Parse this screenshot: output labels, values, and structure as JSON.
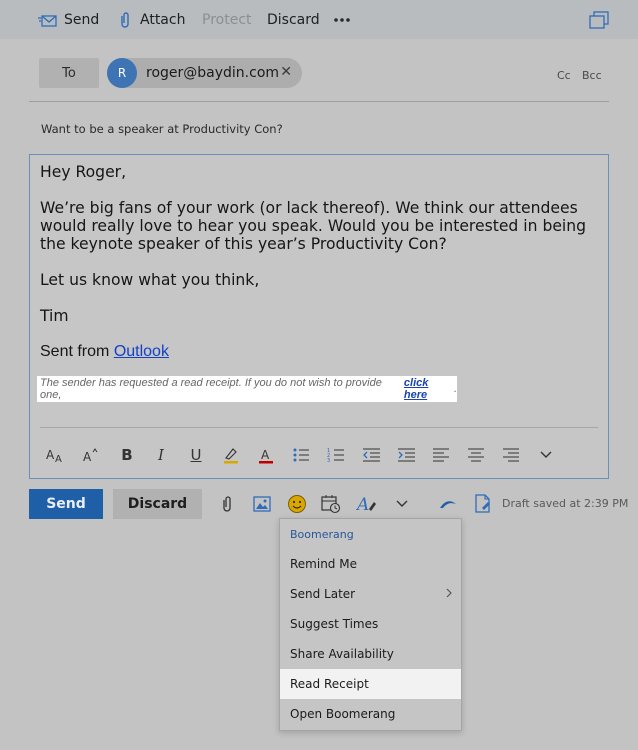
{
  "toolbar": {
    "send": "Send",
    "attach": "Attach",
    "protect": "Protect",
    "discard": "Discard"
  },
  "recipients": {
    "to_label": "To",
    "items": [
      {
        "initial": "R",
        "email": "roger@baydin.com"
      }
    ],
    "cc": "Cc",
    "bcc": "Bcc"
  },
  "subject": "Want to be a speaker at Productivity Con?",
  "body": {
    "greeting": "Hey Roger,",
    "paragraph": "We’re big fans of your work (or lack thereof). We think our attendees would really love to hear you speak. Would you be interested in being the keynote speaker of this year’s Productivity Con?",
    "closing": "Let us know what you think,",
    "signature": "Tim",
    "sent_from_prefix": "Sent from ",
    "sent_from_link": "Outlook",
    "receipt_note": "The sender has requested a read receipt. If you do not wish to provide one,",
    "receipt_link": "click here",
    "receipt_end": "."
  },
  "actions": {
    "send": "Send",
    "discard": "Discard",
    "draft_status": "Draft saved at 2:39 PM"
  },
  "menu": {
    "header": "Boomerang",
    "items": [
      {
        "label": "Remind Me",
        "active": false
      },
      {
        "label": "Send Later",
        "active": false,
        "submenu": true
      },
      {
        "label": "Suggest Times",
        "active": false
      },
      {
        "label": "Share Availability",
        "active": false
      },
      {
        "label": "Read Receipt",
        "active": true
      },
      {
        "label": "Open Boomerang",
        "active": false
      }
    ]
  },
  "colors": {
    "accent": "#1f5fa8",
    "avatar": "#3e74b3",
    "link": "#1440c9",
    "menu_header": "#26579a",
    "overlay_background": "#c3c3c3"
  },
  "icons": {
    "toolbar": [
      "send-mail-icon",
      "paperclip-icon",
      "more-dots-icon",
      "popout-window-icon"
    ],
    "format": [
      "font-size-icon",
      "grow-font-icon",
      "bold-icon",
      "italic-icon",
      "underline-icon",
      "highlight-icon",
      "font-color-icon",
      "bullets-icon",
      "numbering-icon",
      "decrease-indent-icon",
      "increase-indent-icon",
      "align-left-icon",
      "align-center-icon",
      "align-right-icon",
      "more-formatting-icon"
    ],
    "actions": [
      "attach-icon",
      "insert-picture-icon",
      "emoji-icon",
      "schedule-icon",
      "formatting-icon",
      "chevron-down-icon",
      "boomerang-icon",
      "save-draft-icon"
    ]
  }
}
